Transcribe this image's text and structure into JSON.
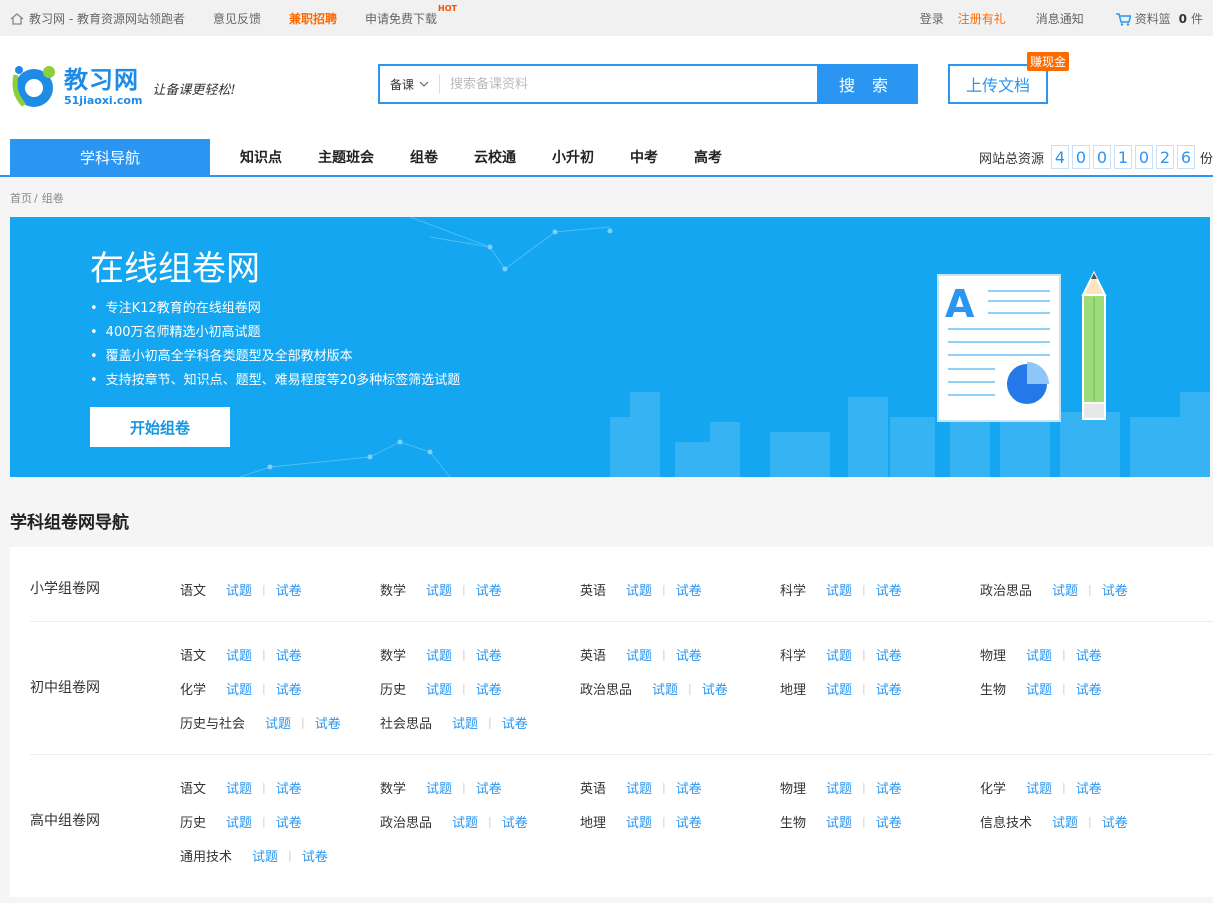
{
  "topbar": {
    "site": "教习网 - 教育资源网站领跑者",
    "feedback": "意见反馈",
    "jobs": "兼职招聘",
    "download": "申请免费下载",
    "hot": "HOT",
    "login": "登录",
    "register": "注册有礼",
    "messages": "消息通知",
    "basket_label": "资料篮",
    "basket_count": "0",
    "basket_unit": "件"
  },
  "logo": {
    "title": "教习网",
    "url": "51jiaoxi.com",
    "slogan": "让备课更轻松!"
  },
  "search": {
    "category": "备课",
    "placeholder": "搜索备课资料",
    "button": "搜 索"
  },
  "upload": {
    "label": "上传文档",
    "badge": "赚现金"
  },
  "nav": {
    "main": "学科导航",
    "items": [
      "知识点",
      "主题班会",
      "组卷",
      "云校通",
      "小升初",
      "中考",
      "高考"
    ],
    "counter_label": "网站总资源",
    "counter_digits": [
      "4",
      "0",
      "0",
      "1",
      "0",
      "2",
      "6"
    ],
    "counter_unit": "份"
  },
  "breadcrumb": {
    "home": "首页",
    "sep": "/",
    "current": "组卷"
  },
  "banner": {
    "title": "在线组卷网",
    "points": [
      "专注K12教育的在线组卷网",
      "400万名师精选小初高试题",
      "覆盖小初高全学科各类题型及全部教材版本",
      "支持按章节、知识点、题型、难易程度等20多种标签筛选试题"
    ],
    "button": "开始组卷"
  },
  "section": {
    "title": "学科组卷网导航",
    "link_question": "试题",
    "link_paper": "试卷",
    "rows": [
      {
        "label": "小学组卷网",
        "subjects": [
          "语文",
          "数学",
          "英语",
          "科学",
          "政治思品"
        ]
      },
      {
        "label": "初中组卷网",
        "subjects": [
          "语文",
          "数学",
          "英语",
          "科学",
          "物理",
          "化学",
          "历史",
          "政治思品",
          "地理",
          "生物",
          "历史与社会",
          "社会思品"
        ]
      },
      {
        "label": "高中组卷网",
        "subjects": [
          "语文",
          "数学",
          "英语",
          "物理",
          "化学",
          "历史",
          "政治思品",
          "地理",
          "生物",
          "信息技术",
          "通用技术"
        ]
      }
    ]
  },
  "colors": {
    "primary": "#2a96f2",
    "banner": "#14a6f0",
    "accent": "#ff6a00"
  }
}
